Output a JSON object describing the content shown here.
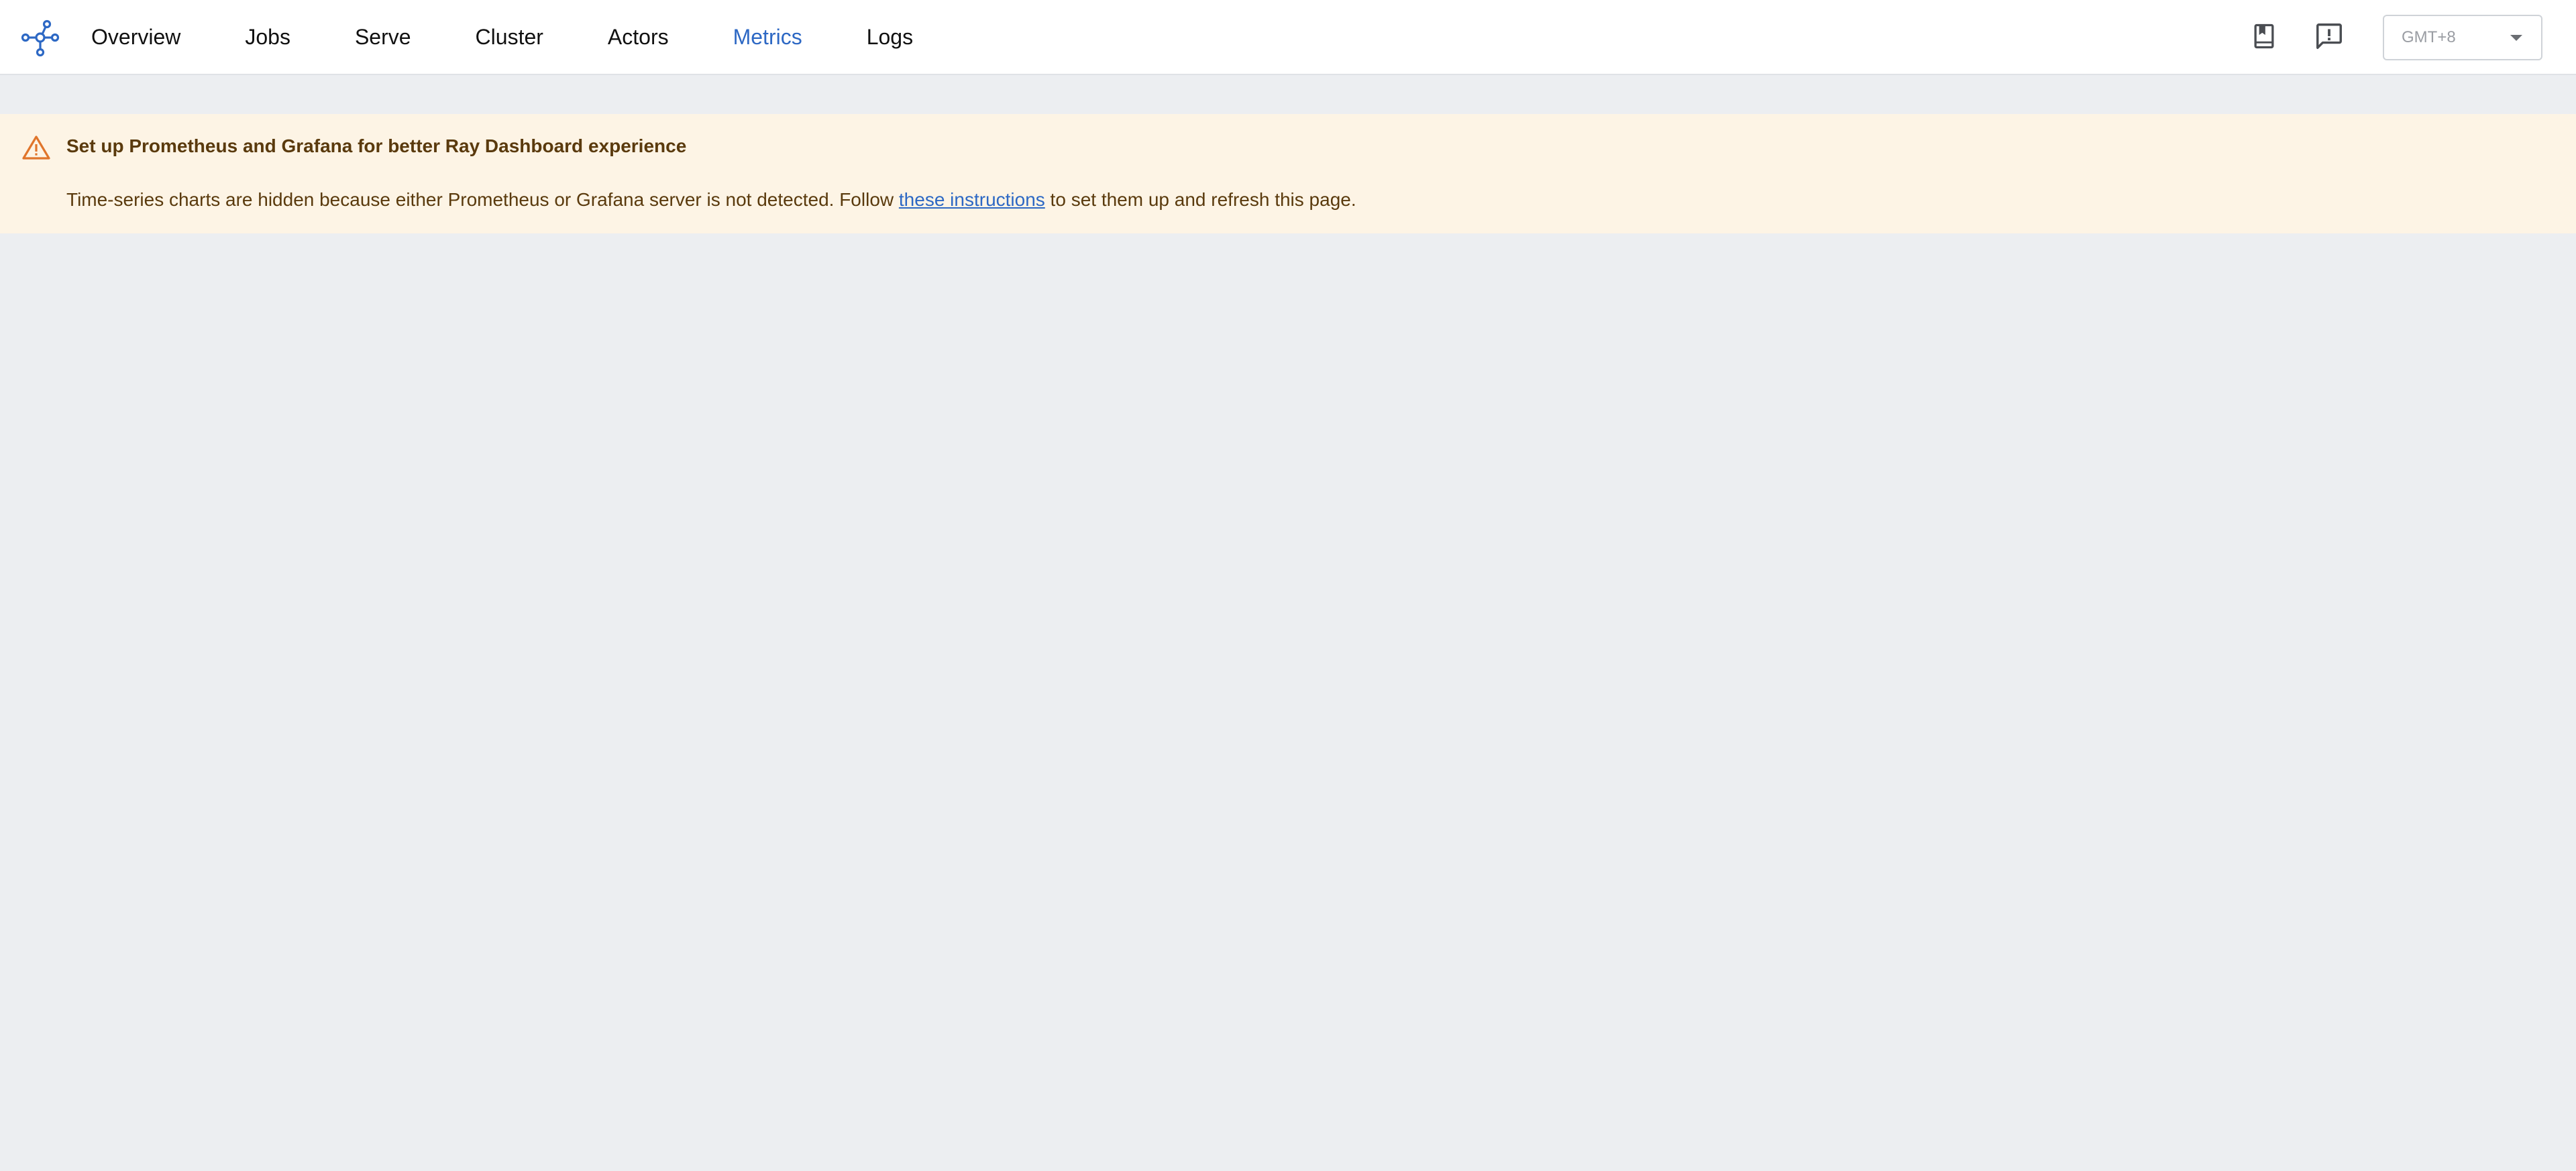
{
  "nav": {
    "tabs": [
      {
        "label": "Overview",
        "active": false
      },
      {
        "label": "Jobs",
        "active": false
      },
      {
        "label": "Serve",
        "active": false
      },
      {
        "label": "Cluster",
        "active": false
      },
      {
        "label": "Actors",
        "active": false
      },
      {
        "label": "Metrics",
        "active": true
      },
      {
        "label": "Logs",
        "active": false
      }
    ]
  },
  "header": {
    "docs_icon": "book-icon",
    "feedback_icon": "feedback-icon",
    "timezone": {
      "value": "GMT+8"
    }
  },
  "alert": {
    "severity": "warning",
    "title": "Set up Prometheus and Grafana for better Ray Dashboard experience",
    "body_prefix": "Time-series charts are hidden because either Prometheus or Grafana server is not detected. Follow ",
    "link_text": "these instructions",
    "body_suffix": " to set them up and refresh this page."
  },
  "colors": {
    "accent": "#2d68c4",
    "warning_bg": "#fdf4e5",
    "warning_text": "#5a3a0d",
    "warning_icon": "#e0752b",
    "page_bg": "#eceef1"
  }
}
